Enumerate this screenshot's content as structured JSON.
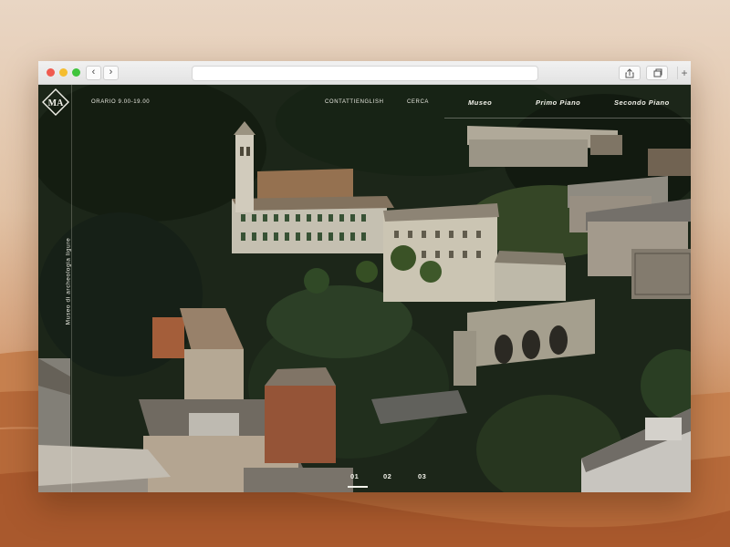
{
  "site": {
    "hours": "ORARIO 9.00-19.00",
    "contacts": "CONTATTI",
    "language": "ENGLISH",
    "search": "CERCA",
    "nav": [
      "Museo",
      "Primo Piano",
      "Secondo Piano"
    ],
    "vertical_title": "Museo di archeologia ligure",
    "pager": [
      "01",
      "02",
      "03"
    ]
  },
  "browser": {
    "back_glyph": "‹",
    "forward_glyph": "›",
    "new_tab_glyph": "+"
  },
  "colors": {
    "accent": "#f2f2ea",
    "traffic_red": "#f05a4f",
    "traffic_yellow": "#f5bd2f",
    "traffic_green": "#3fc43c"
  }
}
